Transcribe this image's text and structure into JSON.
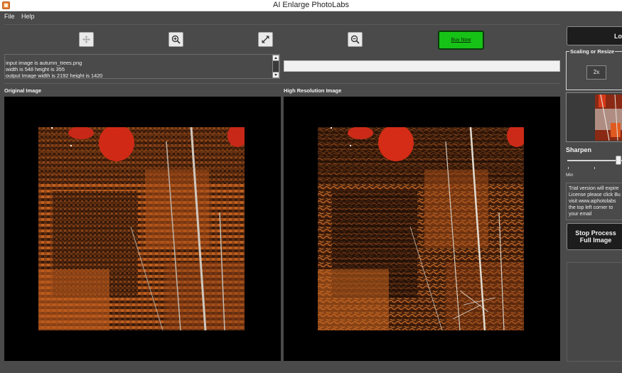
{
  "window": {
    "title": "AI Enlarge PhotoLabs"
  },
  "menu": {
    "file": "File",
    "help": "Help"
  },
  "toolbar": {
    "buttons": [
      {
        "name": "move-icon"
      },
      {
        "name": "zoom-in-icon"
      },
      {
        "name": "fit-to-window-icon"
      },
      {
        "name": "zoom-out-icon"
      }
    ],
    "buy_label": "Buy Now"
  },
  "info": {
    "lines": [
      "input image is autumn_trees.png",
      "width is 548 height is 355",
      "output Image width is 2192 height is 1420"
    ]
  },
  "panels": {
    "original_label": "Original Image",
    "high_res_label": "High Resolution Image"
  },
  "sidebar": {
    "load_label": "Lo",
    "scaling_title": "Scaling or Resize",
    "scale_option": "2x",
    "sharpen_label": "Sharpen",
    "min_label": "Min",
    "trial_lines": [
      "Trial version will expire",
      "License please click Bu",
      "visit www.aiphotolabs",
      "the top left corner to",
      "your email"
    ],
    "stop_line1": "Stop Process",
    "stop_line2": "Full Image"
  },
  "colors": {
    "background": "#4a4a4a",
    "buy_button": "#17c217",
    "dark_button": "#1d1d1d"
  }
}
